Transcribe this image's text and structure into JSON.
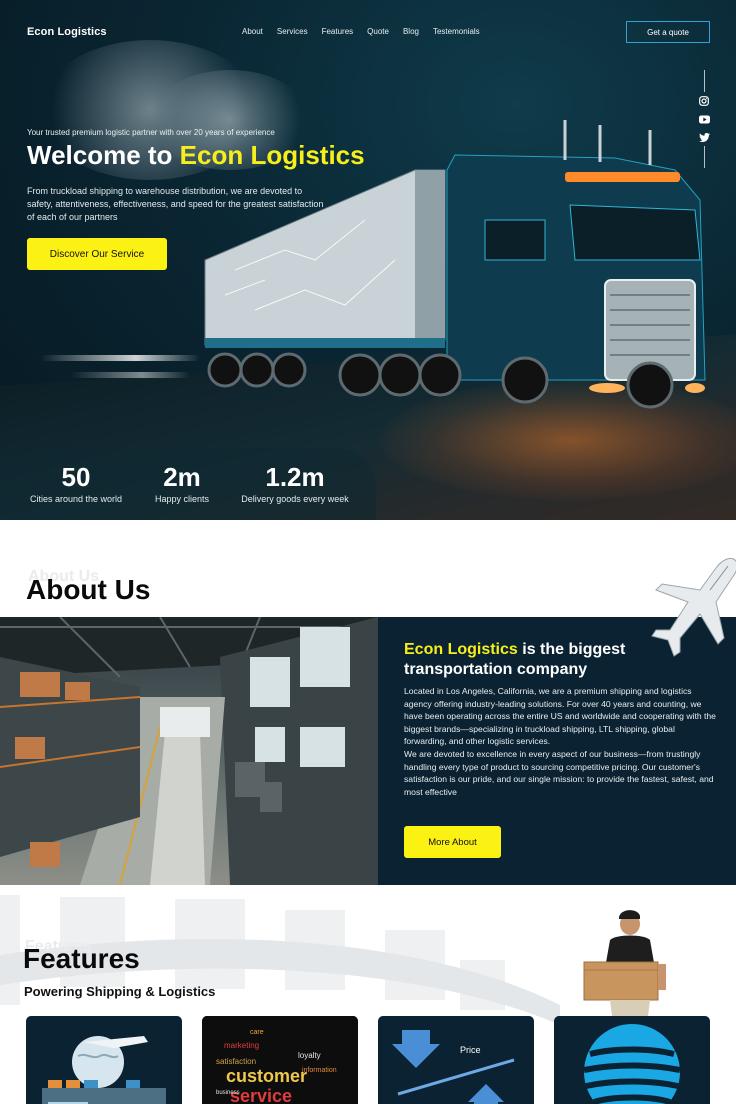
{
  "brand": {
    "name": "Econ Logistics",
    "accent": "#fbf214",
    "dark": "#0a2231",
    "outline": "#2fa3d8"
  },
  "nav": {
    "links": [
      "About",
      "Services",
      "Features",
      "Quote",
      "Blog",
      "Testemonials"
    ],
    "cta": "Get a quote"
  },
  "social": [
    "instagram-icon",
    "youtube-icon",
    "twitter-icon"
  ],
  "hero": {
    "tagline": "Your trusted premium logistic partner with over 20 years of experience",
    "headline_prefix": "Welcome to ",
    "headline_highlight": "Econ Logistics",
    "description": "From truckload shipping to warehouse distribution, we are devoted to safety, attentiveness, effectiveness, and speed for the greatest satisfaction of each of our partners",
    "cta": "Discover Our Service",
    "stats": [
      {
        "value": "50",
        "label": "Cities around the world"
      },
      {
        "value": "2m",
        "label": "Happy clients"
      },
      {
        "value": "1.2m",
        "label": "Delivery goods every week"
      }
    ]
  },
  "about": {
    "ghost": "About Us",
    "title": "About Us",
    "heading_highlight": "Econ Logistics",
    "heading_rest": " is the biggest transportation company",
    "paragraph1": "Located in Los Angeles, California, we are a premium shipping and logistics agency offering industry-leading solutions. For over 40 years and counting, we have been operating across the entire US and worldwide and cooperating with the biggest brands—specializing in truckload shipping, LTL shipping, global forwarding, and other logistic services.",
    "paragraph2": "We are devoted to excellence in every aspect of our business—from trustingly handling every type of product to sourcing competitive pricing. Our customer's satisfaction is our pride, and our single mission: to provide the fastest, safest, and most effective",
    "cta": "More About"
  },
  "features": {
    "ghost": "Features",
    "title": "Features",
    "subtitle": "Powering Shipping & Logistics",
    "cards": [
      {
        "icon": "globe-shipping-icon"
      },
      {
        "icon": "word-cloud-icon",
        "words": [
          "care",
          "marketing",
          "satisfaction",
          "customer",
          "loyalty",
          "service",
          "information",
          "business"
        ]
      },
      {
        "icon": "price-arrows-icon",
        "label": "Price"
      },
      {
        "icon": "att-globe-icon"
      }
    ]
  }
}
